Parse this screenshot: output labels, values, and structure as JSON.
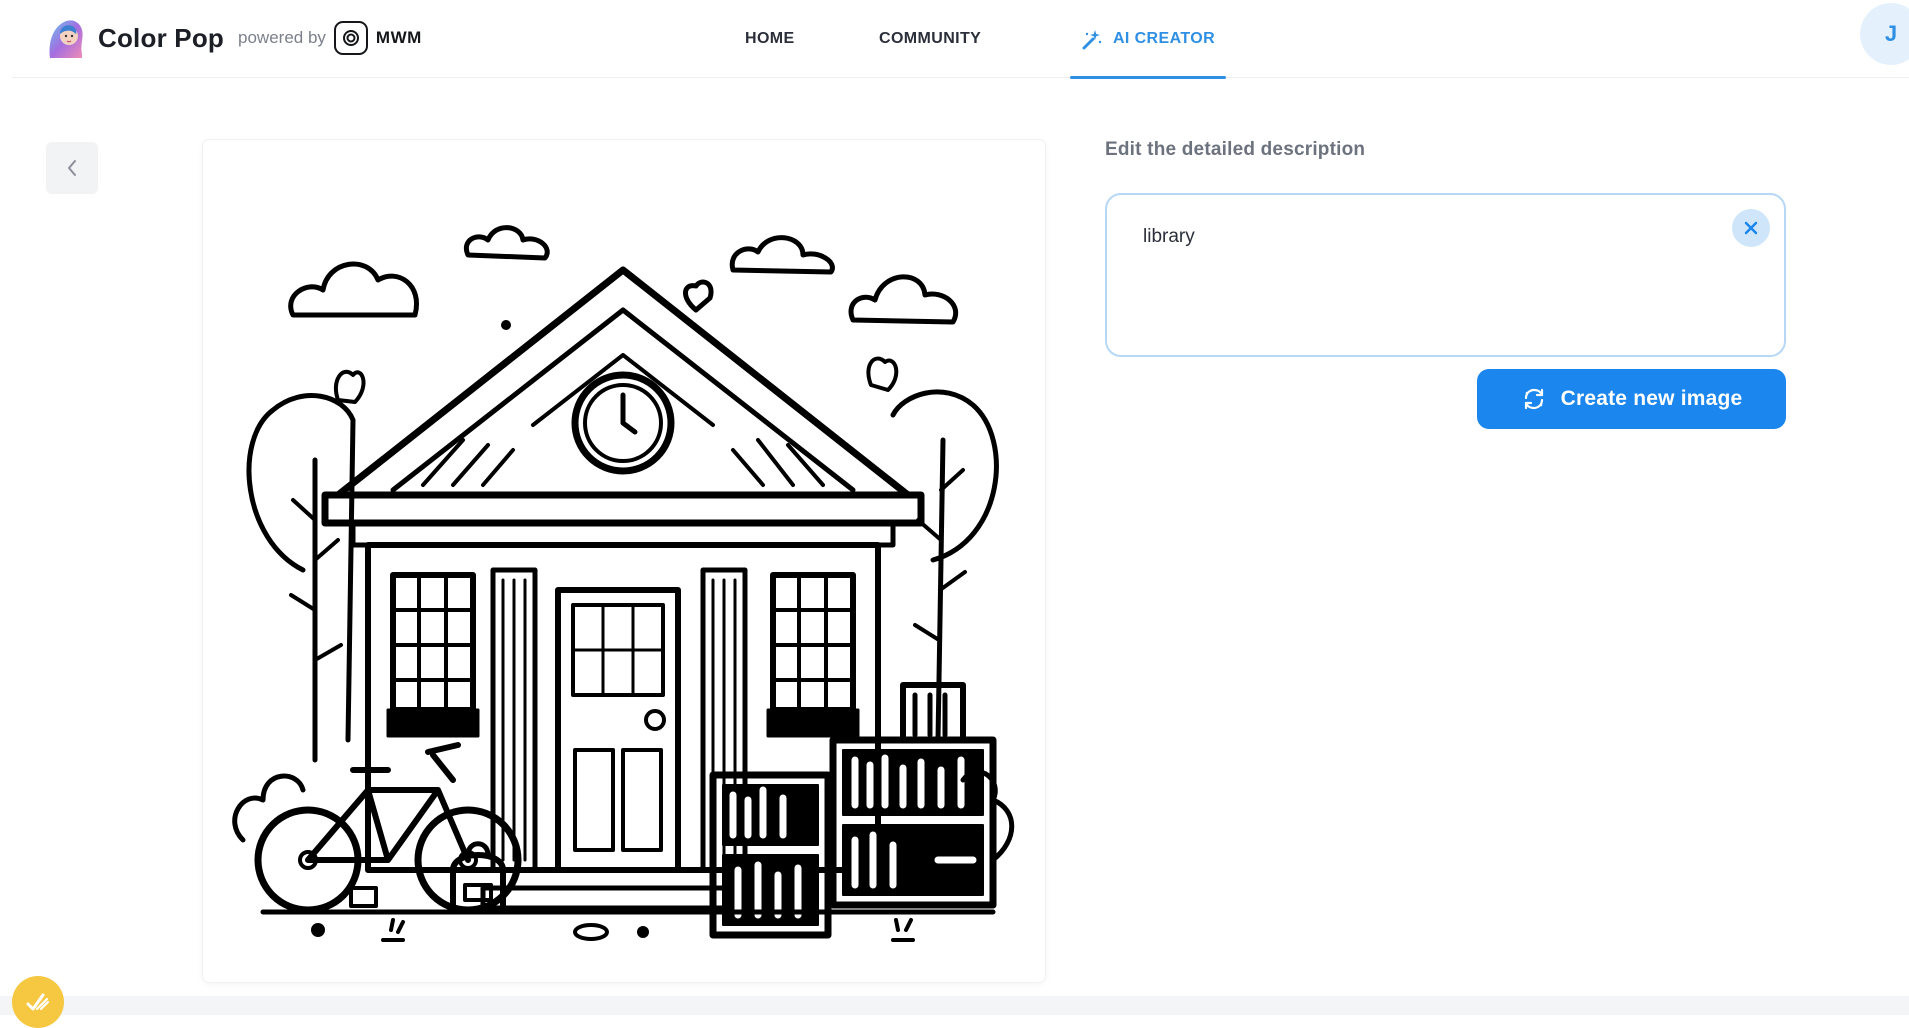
{
  "header": {
    "brand_name": "Color Pop",
    "powered_by": "powered by",
    "partner": "MWM",
    "nav": [
      {
        "label": "HOME",
        "active": false
      },
      {
        "label": "COMMUNITY",
        "active": false
      },
      {
        "label": "AI CREATOR",
        "active": true
      }
    ],
    "avatar_initial": "J"
  },
  "editor": {
    "description_label": "Edit the detailed description",
    "description_value": "library",
    "create_button_label": "Create new image"
  },
  "colors": {
    "accent": "#1a86ee",
    "active_nav": "#2f8fe3",
    "input_border": "#b6d8f6",
    "helper_badge": "#f6c842"
  },
  "icons": {
    "back": "chevron-left-icon",
    "clear": "close-icon",
    "create": "refresh-icon",
    "ai_creator": "magic-wand-icon",
    "helper": "pencil-check-icon"
  }
}
